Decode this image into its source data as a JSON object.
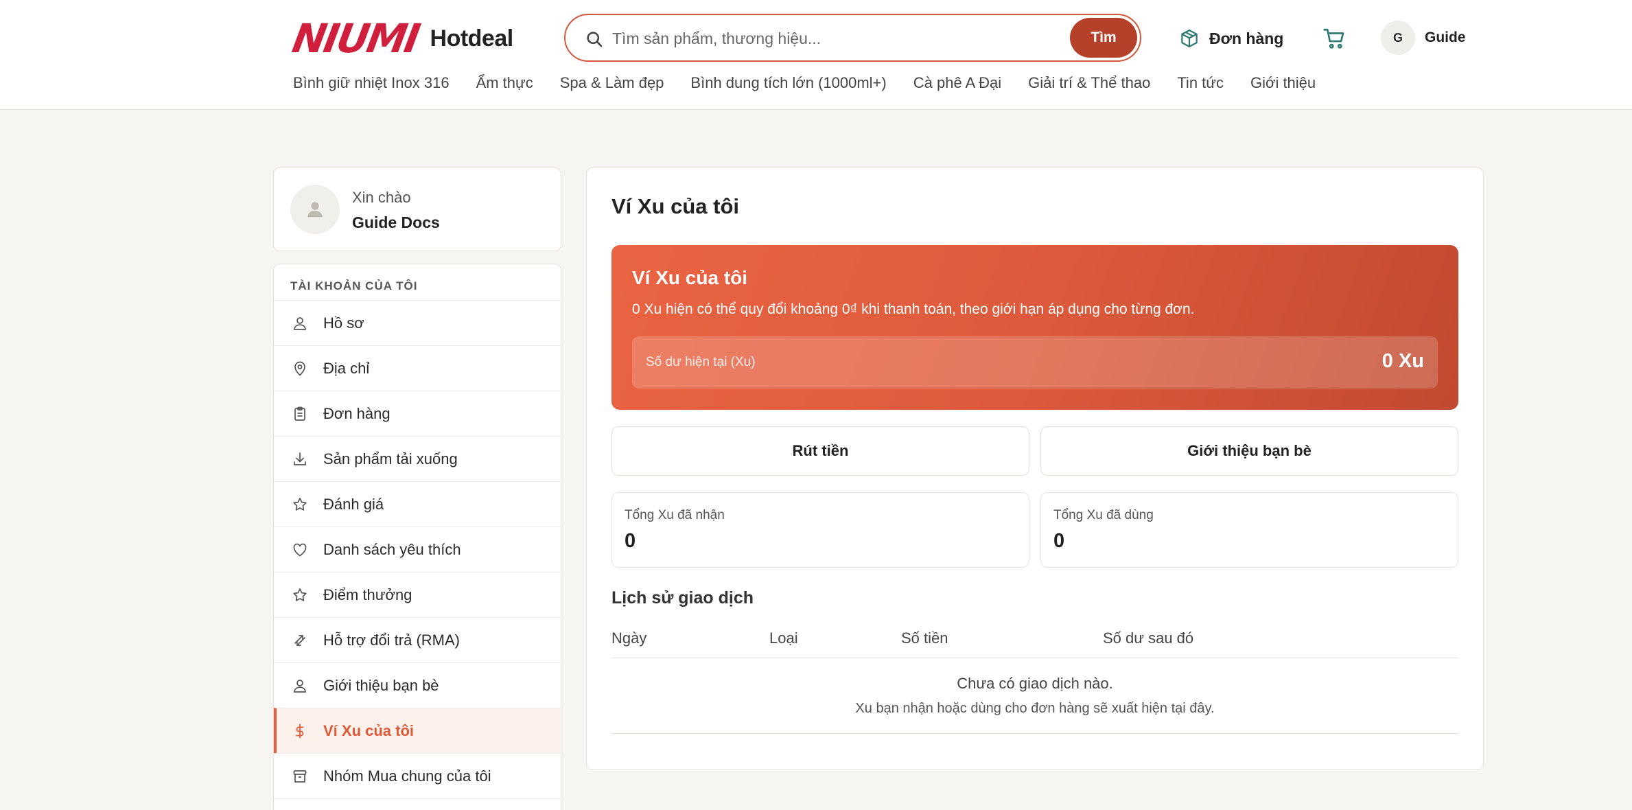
{
  "header": {
    "logo_mark": "NIUMI",
    "logo_text": "Hotdeal",
    "search": {
      "placeholder": "Tìm sản phẩm, thương hiệu...",
      "button_label": "Tìm"
    },
    "orders_label": "Đơn hàng",
    "user": {
      "initial": "G",
      "name": "Guide"
    },
    "categories": [
      "Bình giữ nhiệt Inox 316",
      "Ẩm thực",
      "Spa & Làm đẹp",
      "Bình dung tích lớn (1000ml+)",
      "Cà phê A Đại",
      "Giải trí & Thể thao",
      "Tin tức",
      "Giới thiệu"
    ]
  },
  "sidebar": {
    "greeting": "Xin chào",
    "user_name": "Guide Docs",
    "section_title": "TÀI KHOẢN CỦA TÔI",
    "items": [
      {
        "label": "Hồ sơ",
        "icon": "user-icon"
      },
      {
        "label": "Địa chỉ",
        "icon": "map-pin-icon"
      },
      {
        "label": "Đơn hàng",
        "icon": "clipboard-icon"
      },
      {
        "label": "Sản phẩm tải xuống",
        "icon": "download-icon"
      },
      {
        "label": "Đánh giá",
        "icon": "star-icon"
      },
      {
        "label": "Danh sách yêu thích",
        "icon": "heart-icon"
      },
      {
        "label": "Điểm thưởng",
        "icon": "star-icon"
      },
      {
        "label": "Hỗ trợ đổi trả (RMA)",
        "icon": "exchange-icon"
      },
      {
        "label": "Giới thiệu bạn bè",
        "icon": "user-icon"
      },
      {
        "label": "Ví Xu của tôi",
        "icon": "dollar-icon",
        "active": true
      },
      {
        "label": "Nhóm Mua chung của tôi",
        "icon": "box-icon"
      }
    ]
  },
  "main": {
    "title": "Ví Xu của tôi",
    "banner": {
      "title": "Ví Xu của tôi",
      "description": "0 Xu hiện có thể quy đổi khoảng 0₫ khi thanh toán, theo giới hạn áp dụng cho từng đơn.",
      "balance_label": "Số dư hiện tại (Xu)",
      "balance_value": "0 Xu"
    },
    "actions": {
      "withdraw": "Rút tiền",
      "refer": "Giới thiệu bạn bè"
    },
    "stats": {
      "received_label": "Tổng Xu đã nhận",
      "received_value": "0",
      "used_label": "Tổng Xu đã dùng",
      "used_value": "0"
    },
    "history": {
      "title": "Lịch sử giao dịch",
      "columns": [
        "Ngày",
        "Loại",
        "Số tiền",
        "Số dư sau đó"
      ],
      "empty_title": "Chưa có giao dịch nào.",
      "empty_desc": "Xu bạn nhận hoặc dùng cho đơn hàng sẽ xuất hiện tại đây."
    }
  },
  "colors": {
    "brand_red": "#d01f3c",
    "accent": "#e85c3d",
    "button": "#b5412a"
  }
}
